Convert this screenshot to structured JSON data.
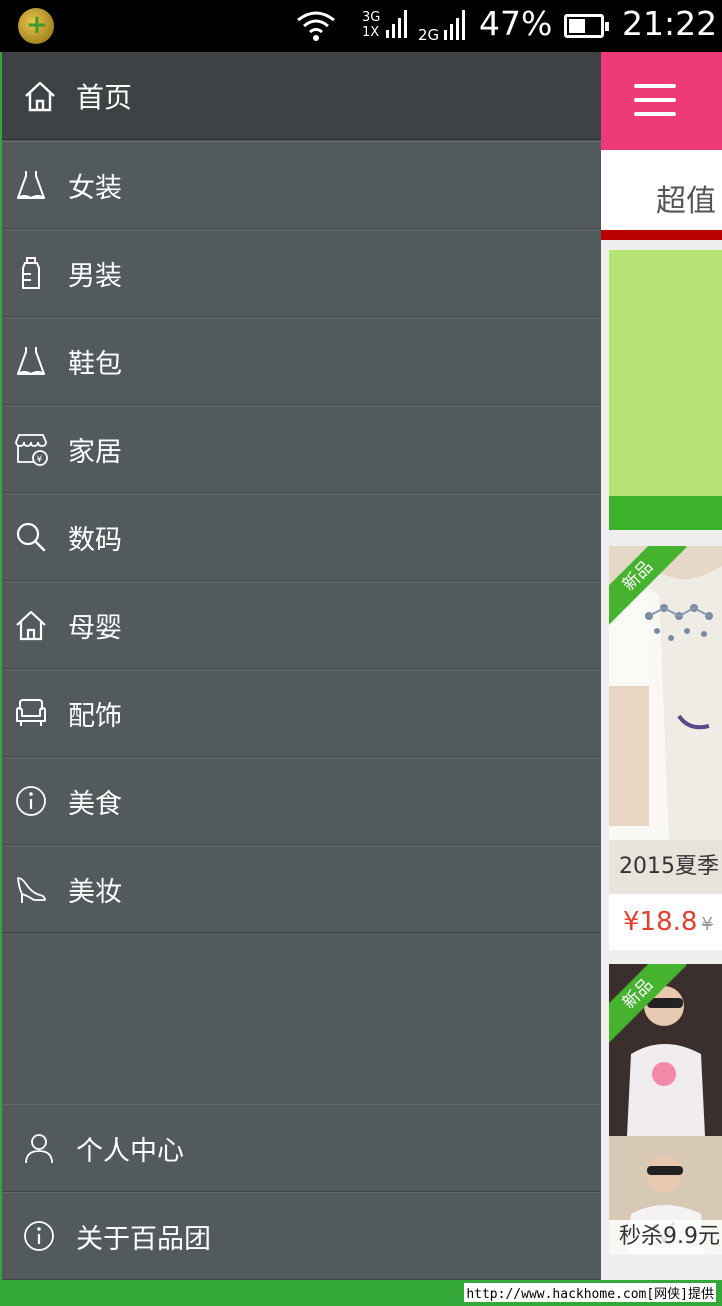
{
  "status_bar": {
    "network1_top": "3G",
    "network1_bottom": "1X",
    "network2": "2G",
    "battery": "47%",
    "time": "21:22"
  },
  "drawer": {
    "home_label": "首页",
    "items": [
      {
        "label": "女装",
        "icon": "dress-icon"
      },
      {
        "label": "男装",
        "icon": "bottle-icon"
      },
      {
        "label": "鞋包",
        "icon": "dress-icon"
      },
      {
        "label": "家居",
        "icon": "store-icon"
      },
      {
        "label": "数码",
        "icon": "search-icon"
      },
      {
        "label": "母婴",
        "icon": "home-icon"
      },
      {
        "label": "配饰",
        "icon": "sofa-icon"
      },
      {
        "label": "美食",
        "icon": "info-icon"
      },
      {
        "label": "美妆",
        "icon": "high-heel-icon"
      }
    ],
    "bottom_items": [
      {
        "label": "个人中心",
        "icon": "user-icon"
      },
      {
        "label": "关于百品团",
        "icon": "info-icon"
      }
    ]
  },
  "content": {
    "tab_label": "超值",
    "cards": [
      {
        "badge": "新品",
        "title": "2015夏季",
        "price": "¥18.8",
        "old_price": "¥"
      },
      {
        "badge": "新品",
        "title": "秒杀9.9元"
      }
    ]
  },
  "watermark": "http://www.hackhome.com[网侠]提供",
  "colors": {
    "accent": "#ee3a76",
    "drawer_bg": "#535a5d",
    "price": "#e43f2f",
    "green": "#35a83a"
  }
}
